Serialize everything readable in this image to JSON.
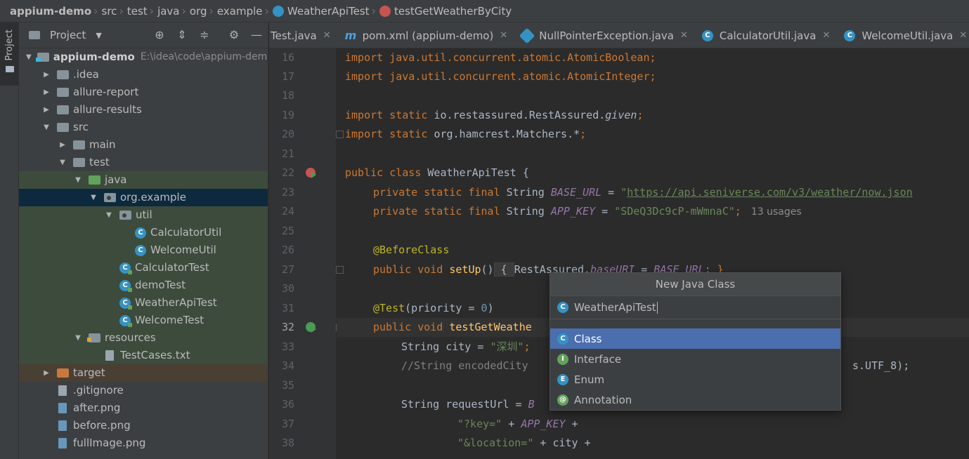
{
  "breadcrumbs": {
    "items": [
      "appium-demo",
      "src",
      "test",
      "java",
      "org",
      "example",
      "WeatherApiTest",
      "testGetWeatherByCity"
    ]
  },
  "stripe": {
    "project_label": "Project"
  },
  "project_panel": {
    "title": "Project",
    "tree": [
      {
        "label": "appium-demo",
        "hint": "E:\\idea\\code\\appium-demo"
      },
      {
        "label": ".idea"
      },
      {
        "label": "allure-report"
      },
      {
        "label": "allure-results"
      },
      {
        "label": "src"
      },
      {
        "label": "main"
      },
      {
        "label": "test"
      },
      {
        "label": "java"
      },
      {
        "label": "org.example"
      },
      {
        "label": "util"
      },
      {
        "label": "CalculatorUtil"
      },
      {
        "label": "WelcomeUtil"
      },
      {
        "label": "CalculatorTest"
      },
      {
        "label": "demoTest"
      },
      {
        "label": "WeatherApiTest"
      },
      {
        "label": "WelcomeTest"
      },
      {
        "label": "resources"
      },
      {
        "label": "TestCases.txt"
      },
      {
        "label": "target"
      },
      {
        "label": ".gitignore"
      },
      {
        "label": "after.png"
      },
      {
        "label": "before.png"
      },
      {
        "label": "fullImage.png"
      }
    ]
  },
  "tabs": [
    {
      "label": "Test.java"
    },
    {
      "label": "pom.xml (appium-demo)"
    },
    {
      "label": "NullPointerException.java"
    },
    {
      "label": "CalculatorUtil.java"
    },
    {
      "label": "WelcomeUtil.java"
    }
  ],
  "editor": {
    "line_numbers": [
      "16",
      "17",
      "18",
      "19",
      "20",
      "21",
      "22",
      "23",
      "24",
      "25",
      "26",
      "27",
      "30",
      "31",
      "32",
      "33",
      "34",
      "35",
      "36",
      "37",
      "38"
    ],
    "current_line": "32",
    "lines": {
      "l16": {
        "a": "import java.util.concurrent.atomic.AtomicBoolean",
        "b": ";"
      },
      "l17": {
        "a": "import java.util.concurrent.atomic.AtomicInteger",
        "b": ";"
      },
      "l19": {
        "kw": "import static ",
        "a": "io.restassured.RestAssured.",
        "it": "given",
        "b": ";"
      },
      "l20": {
        "kw": "import static ",
        "a": "org.hamcrest.Matchers.*",
        "b": ";"
      },
      "l22": {
        "kw": "public class ",
        "a": "WeatherApiTest {"
      },
      "l23": {
        "kw": "private static final ",
        "t": "String ",
        "f": "BASE_URL",
        "eq": " = ",
        "q": "\"",
        "url": "https://api.seniverse.com/v3/weather/now.json"
      },
      "l24": {
        "kw": "private static final ",
        "t": "String ",
        "f": "APP_KEY",
        "eq": " = ",
        "s": "\"SDeQ3Dc9cP-mWmnaC\"",
        "b": ";",
        "usages": "13 usages"
      },
      "l26": {
        "ann": "@BeforeClass"
      },
      "l27": {
        "kw": "public void ",
        "fn": "setUp",
        "p": "()",
        "o": " { ",
        "a": "RestAssured.",
        "f": "baseURI",
        "eq": " = ",
        "f2": "BASE_URL",
        "b": "; }"
      },
      "l31": {
        "ann": "@Test",
        "a": "(priority = ",
        "n": "0",
        "b": ")"
      },
      "l32": {
        "kw": "public void ",
        "fn": "testGetWeathe"
      },
      "l33": {
        "t": "String city = ",
        "s": "\"深圳\"",
        "b": ";"
      },
      "l34": {
        "cm": "//String encodedCity",
        "tail": "s.UTF_8);"
      },
      "l36": {
        "t": "String requestUrl = ",
        "f": "B"
      },
      "l37": {
        "s": "\"?key=\"",
        "a": " + ",
        "f": "APP_KEY",
        "b": " +"
      },
      "l38": {
        "s": "\"&location=\"",
        "a": " + city +"
      }
    }
  },
  "popup": {
    "title": "New Java Class",
    "input_value": "WeatherApiTest",
    "options": [
      {
        "label": "Class",
        "icon": "C",
        "color": "#3592c4"
      },
      {
        "label": "Interface",
        "icon": "I",
        "color": "#62a35c"
      },
      {
        "label": "Enum",
        "icon": "E",
        "color": "#3592c4"
      },
      {
        "label": "Annotation",
        "icon": "@",
        "color": "#62a35c"
      }
    ],
    "selected_option": "Class"
  },
  "colors": {
    "selection_blue": "#4b6eaf",
    "keyword": "#cc7832",
    "string": "#6a8759",
    "field": "#9876aa"
  }
}
